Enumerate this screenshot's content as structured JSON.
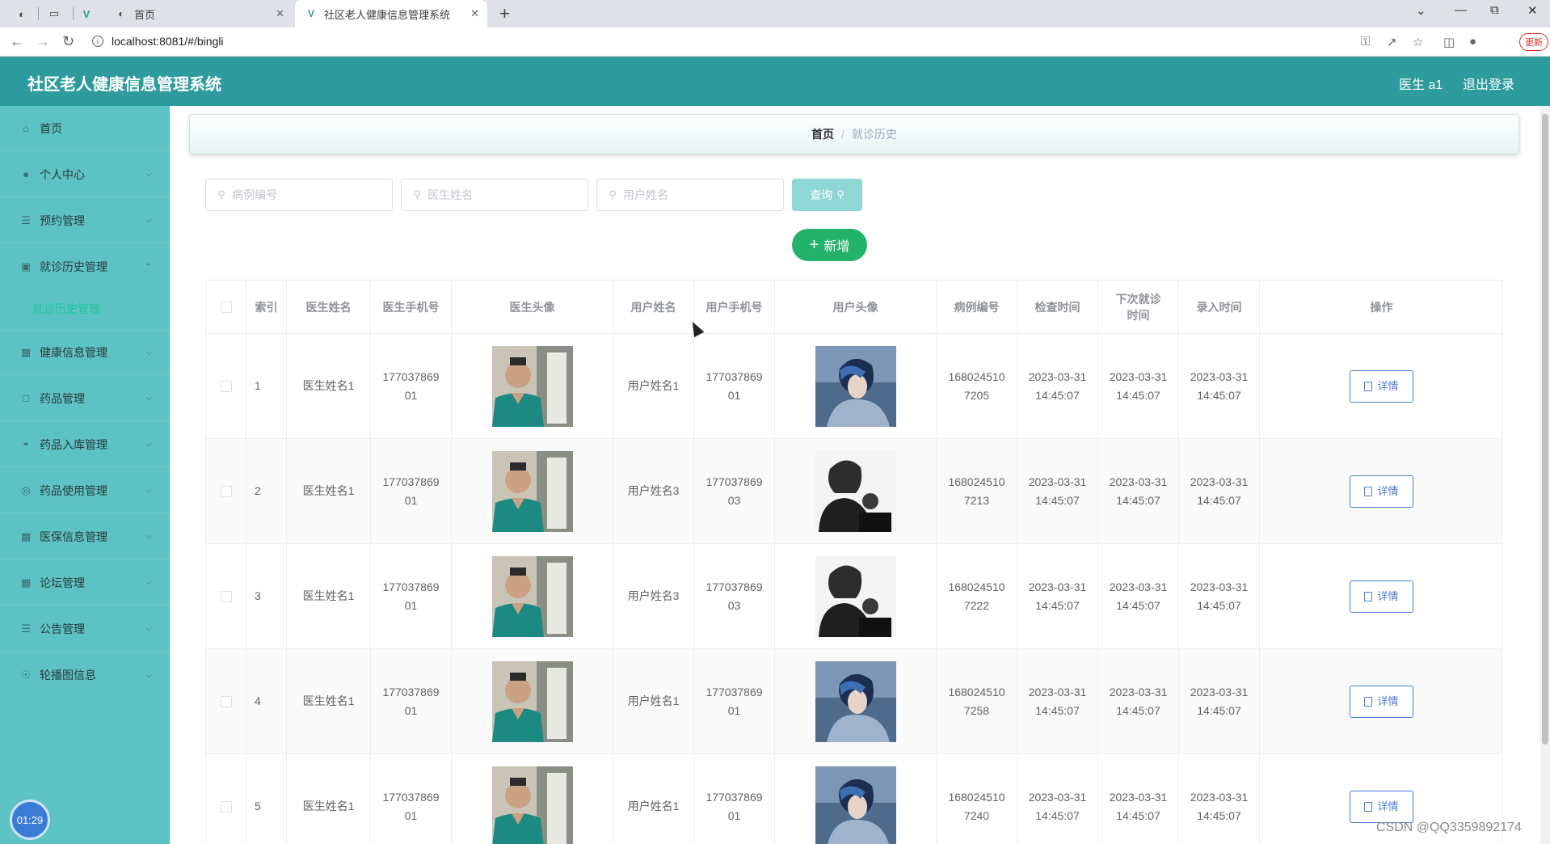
{
  "browser": {
    "tabs": [
      {
        "label": "首页",
        "active": false
      },
      {
        "label": "社区老人健康信息管理系统",
        "active": true
      }
    ],
    "url": "localhost:8081/#/bingli",
    "update_label": "更新"
  },
  "header": {
    "title": "社区老人健康信息管理系统",
    "user": "医生 a1",
    "logout": "退出登录"
  },
  "sidebar": {
    "items": [
      {
        "label": "首页",
        "icon": "home-icon"
      },
      {
        "label": "个人中心",
        "icon": "user-icon"
      },
      {
        "label": "预约管理",
        "icon": "list-icon"
      },
      {
        "label": "就诊历史管理",
        "icon": "record-icon"
      },
      {
        "label": "健康信息管理",
        "icon": "health-icon"
      },
      {
        "label": "药品管理",
        "icon": "drug-icon"
      },
      {
        "label": "药品入库管理",
        "icon": "stock-in-icon"
      },
      {
        "label": "药品使用管理",
        "icon": "drug-use-icon"
      },
      {
        "label": "医保信息管理",
        "icon": "insurance-icon"
      },
      {
        "label": "论坛管理",
        "icon": "forum-icon"
      },
      {
        "label": "公告管理",
        "icon": "notice-icon"
      },
      {
        "label": "轮播图信息",
        "icon": "carousel-icon"
      }
    ],
    "active_sub": "就诊历史管理",
    "timer": "01:29"
  },
  "breadcrumb": {
    "home": "首页",
    "sep": "/",
    "current": "就诊历史"
  },
  "search": {
    "case_no_placeholder": "病例编号",
    "doctor_name_placeholder": "医生姓名",
    "user_name_placeholder": "用户姓名",
    "query_label": "查询",
    "add_label": "新增"
  },
  "table": {
    "headers": [
      "索引",
      "医生姓名",
      "医生手机号",
      "医生头像",
      "用户姓名",
      "用户手机号",
      "用户头像",
      "病例编号",
      "检查时间",
      "下次就诊时间",
      "录入时间",
      "操作"
    ],
    "detail_label": "详情",
    "rows": [
      {
        "index": "1",
        "doctor_name": "医生姓名1",
        "doctor_phone": "17703786901",
        "user_name": "用户姓名1",
        "user_phone": "17703786901",
        "user_avatar": "blue-portrait",
        "case_no": "1680245107205",
        "check_time": "2023-03-31 14:45:07",
        "next_visit": "2023-03-31 14:45:07",
        "entry_time": "2023-03-31 14:45:07"
      },
      {
        "index": "2",
        "doctor_name": "医生姓名1",
        "doctor_phone": "17703786901",
        "user_name": "用户姓名3",
        "user_phone": "17703786903",
        "user_avatar": "bw-portrait",
        "case_no": "1680245107213",
        "check_time": "2023-03-31 14:45:07",
        "next_visit": "2023-03-31 14:45:07",
        "entry_time": "2023-03-31 14:45:07"
      },
      {
        "index": "3",
        "doctor_name": "医生姓名1",
        "doctor_phone": "17703786901",
        "user_name": "用户姓名3",
        "user_phone": "17703786903",
        "user_avatar": "bw-portrait",
        "case_no": "1680245107222",
        "check_time": "2023-03-31 14:45:07",
        "next_visit": "2023-03-31 14:45:07",
        "entry_time": "2023-03-31 14:45:07"
      },
      {
        "index": "4",
        "doctor_name": "医生姓名1",
        "doctor_phone": "17703786901",
        "user_name": "用户姓名1",
        "user_phone": "17703786901",
        "user_avatar": "blue-portrait",
        "case_no": "1680245107258",
        "check_time": "2023-03-31 14:45:07",
        "next_visit": "2023-03-31 14:45:07",
        "entry_time": "2023-03-31 14:45:07"
      },
      {
        "index": "5",
        "doctor_name": "医生姓名1",
        "doctor_phone": "17703786901",
        "user_name": "用户姓名1",
        "user_phone": "17703786901",
        "user_avatar": "blue-portrait",
        "case_no": "1680245107240",
        "check_time": "2023-03-31 14:45:07",
        "next_visit": "2023-03-31 14:45:07",
        "entry_time": "2023-03-31 14:45:07"
      }
    ]
  },
  "watermark": "CSDN @QQ3359892174"
}
